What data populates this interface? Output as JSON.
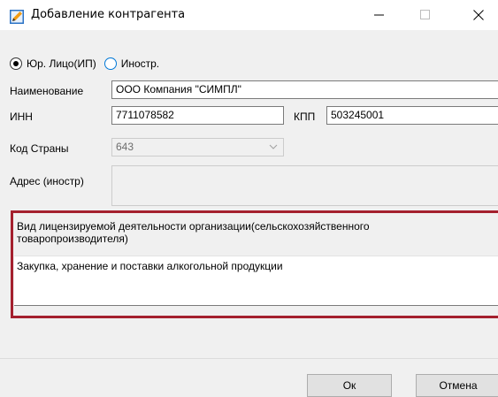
{
  "window": {
    "title": "Добавление контрагента",
    "icon": "edit-pencil-icon",
    "accent_color": "#0078d7"
  },
  "entity_type": {
    "options": [
      {
        "label": "Юр. Лицо(ИП)",
        "checked": true
      },
      {
        "label": "Иностр.",
        "checked": false
      }
    ]
  },
  "form": {
    "name_label": "Наименование",
    "name_value": "ООО Компания \"СИМПЛ\"",
    "inn_label": "ИНН",
    "inn_value": "7711078582",
    "kpp_label": "КПП",
    "kpp_value": "503245001",
    "country_label": "Код Страны",
    "country_value": "643",
    "address_label": "Адрес (иностр)",
    "address_value": ""
  },
  "license": {
    "label": "Вид лицензируемой деятельности организации(сельскохозяйственного товаропроизводителя)",
    "value": "Закупка, хранение и поставки алкогольной продукции",
    "highlight_color": "#a4202e"
  },
  "buttons": {
    "ok": "Ок",
    "cancel": "Отмена"
  }
}
